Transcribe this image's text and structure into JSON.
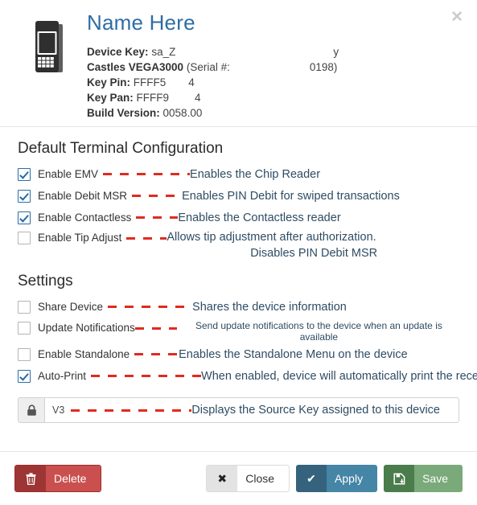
{
  "header": {
    "title": "Name Here",
    "close_icon": "close-icon",
    "device_icon": "payment-terminal-icon",
    "meta": [
      {
        "label": "Device Key:",
        "value": "sa_Z",
        "trailing": "y"
      },
      {
        "label": "Castles VEGA3000",
        "value": "(Serial #:",
        "trailing": "0198)"
      },
      {
        "label": "Key Pin:",
        "value": "FFFF5",
        "trailing": "4"
      },
      {
        "label": "Key Pan:",
        "value": "FFFF9",
        "trailing": "4"
      },
      {
        "label": "Build Version:",
        "value": "0058.00",
        "trailing": ""
      }
    ]
  },
  "terminal_config": {
    "title": "Default Terminal Configuration",
    "items": [
      {
        "label": "Enable EMV",
        "checked": true,
        "annotation": "Enables the Chip Reader",
        "annotation_line2": ""
      },
      {
        "label": "Enable Debit MSR",
        "checked": true,
        "annotation": "Enables PIN Debit for swiped transactions",
        "annotation_line2": ""
      },
      {
        "label": "Enable Contactless",
        "checked": true,
        "annotation": "Enables the Contactless reader",
        "annotation_line2": ""
      },
      {
        "label": "Enable Tip Adjust",
        "checked": false,
        "annotation": "Allows tip adjustment after authorization.",
        "annotation_line2": "Disables PIN Debit MSR"
      }
    ]
  },
  "settings": {
    "title": "Settings",
    "items": [
      {
        "label": "Share Device",
        "checked": false,
        "annotation": "Shares the device information",
        "annotation_line2": ""
      },
      {
        "label": "Update Notifications",
        "checked": false,
        "annotation": "Send update notifications to the device when an update is available",
        "annotation_line2": ""
      },
      {
        "label": "Enable Standalone",
        "checked": false,
        "annotation": "Enables the Standalone Menu on the device",
        "annotation_line2": ""
      },
      {
        "label": "Auto-Print",
        "checked": true,
        "annotation": "When enabled, device will automatically print the receipt",
        "annotation_line2": ""
      }
    ]
  },
  "source_key": {
    "icon": "lock-icon",
    "value": "V3",
    "annotation": "Displays the Source Key assigned to this device"
  },
  "footer": {
    "delete_label": "Delete",
    "delete_icon": "trash-icon",
    "close_label": "Close",
    "close_icon": "x-icon",
    "apply_label": "Apply",
    "apply_icon": "check-icon",
    "save_label": "Save",
    "save_icon": "floppy-disk-icon"
  },
  "colors": {
    "title_blue": "#2e6da4",
    "annotation_blue": "#2e4c63",
    "connector_red": "#e02b20",
    "checkbox_blue": "#2169b0",
    "delete_red": "#c9504f",
    "apply_blue": "#4585a6",
    "save_green": "#7aa97a"
  }
}
